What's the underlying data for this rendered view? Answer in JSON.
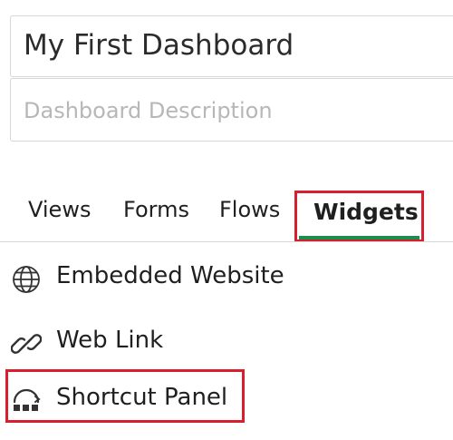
{
  "dashboard": {
    "title": "My First Dashboard",
    "description_placeholder": "Dashboard Description"
  },
  "tabs": [
    {
      "label": "Views",
      "active": false
    },
    {
      "label": "Forms",
      "active": false
    },
    {
      "label": "Flows",
      "active": false
    },
    {
      "label": "Widgets",
      "active": true
    }
  ],
  "widgets": [
    {
      "label": "Embedded Website",
      "icon": "globe-icon"
    },
    {
      "label": "Web Link",
      "icon": "link-icon"
    },
    {
      "label": "Shortcut Panel",
      "icon": "shortcut-panel-icon"
    }
  ],
  "colors": {
    "active_tab_underline": "#1a8f4d",
    "highlight_box": "#d81f2d",
    "placeholder_text": "#b7b7b7",
    "border": "#d6d6d6"
  }
}
